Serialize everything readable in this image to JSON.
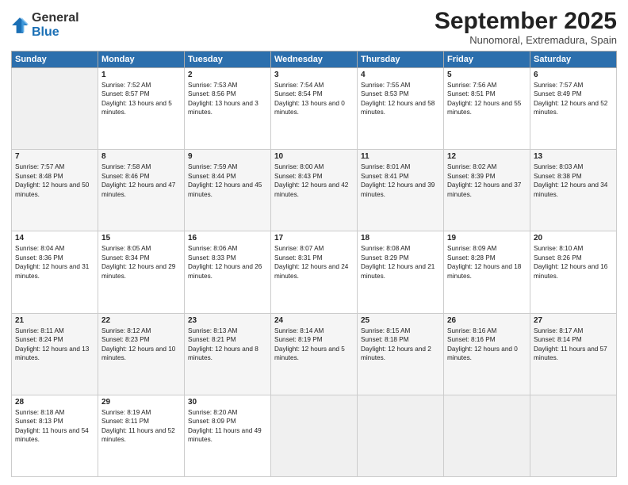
{
  "logo": {
    "general": "General",
    "blue": "Blue"
  },
  "header": {
    "month": "September 2025",
    "location": "Nunomoral, Extremadura, Spain"
  },
  "weekdays": [
    "Sunday",
    "Monday",
    "Tuesday",
    "Wednesday",
    "Thursday",
    "Friday",
    "Saturday"
  ],
  "weeks": [
    [
      {
        "num": "",
        "sunrise": "",
        "sunset": "",
        "daylight": ""
      },
      {
        "num": "1",
        "sunrise": "Sunrise: 7:52 AM",
        "sunset": "Sunset: 8:57 PM",
        "daylight": "Daylight: 13 hours and 5 minutes."
      },
      {
        "num": "2",
        "sunrise": "Sunrise: 7:53 AM",
        "sunset": "Sunset: 8:56 PM",
        "daylight": "Daylight: 13 hours and 3 minutes."
      },
      {
        "num": "3",
        "sunrise": "Sunrise: 7:54 AM",
        "sunset": "Sunset: 8:54 PM",
        "daylight": "Daylight: 13 hours and 0 minutes."
      },
      {
        "num": "4",
        "sunrise": "Sunrise: 7:55 AM",
        "sunset": "Sunset: 8:53 PM",
        "daylight": "Daylight: 12 hours and 58 minutes."
      },
      {
        "num": "5",
        "sunrise": "Sunrise: 7:56 AM",
        "sunset": "Sunset: 8:51 PM",
        "daylight": "Daylight: 12 hours and 55 minutes."
      },
      {
        "num": "6",
        "sunrise": "Sunrise: 7:57 AM",
        "sunset": "Sunset: 8:49 PM",
        "daylight": "Daylight: 12 hours and 52 minutes."
      }
    ],
    [
      {
        "num": "7",
        "sunrise": "Sunrise: 7:57 AM",
        "sunset": "Sunset: 8:48 PM",
        "daylight": "Daylight: 12 hours and 50 minutes."
      },
      {
        "num": "8",
        "sunrise": "Sunrise: 7:58 AM",
        "sunset": "Sunset: 8:46 PM",
        "daylight": "Daylight: 12 hours and 47 minutes."
      },
      {
        "num": "9",
        "sunrise": "Sunrise: 7:59 AM",
        "sunset": "Sunset: 8:44 PM",
        "daylight": "Daylight: 12 hours and 45 minutes."
      },
      {
        "num": "10",
        "sunrise": "Sunrise: 8:00 AM",
        "sunset": "Sunset: 8:43 PM",
        "daylight": "Daylight: 12 hours and 42 minutes."
      },
      {
        "num": "11",
        "sunrise": "Sunrise: 8:01 AM",
        "sunset": "Sunset: 8:41 PM",
        "daylight": "Daylight: 12 hours and 39 minutes."
      },
      {
        "num": "12",
        "sunrise": "Sunrise: 8:02 AM",
        "sunset": "Sunset: 8:39 PM",
        "daylight": "Daylight: 12 hours and 37 minutes."
      },
      {
        "num": "13",
        "sunrise": "Sunrise: 8:03 AM",
        "sunset": "Sunset: 8:38 PM",
        "daylight": "Daylight: 12 hours and 34 minutes."
      }
    ],
    [
      {
        "num": "14",
        "sunrise": "Sunrise: 8:04 AM",
        "sunset": "Sunset: 8:36 PM",
        "daylight": "Daylight: 12 hours and 31 minutes."
      },
      {
        "num": "15",
        "sunrise": "Sunrise: 8:05 AM",
        "sunset": "Sunset: 8:34 PM",
        "daylight": "Daylight: 12 hours and 29 minutes."
      },
      {
        "num": "16",
        "sunrise": "Sunrise: 8:06 AM",
        "sunset": "Sunset: 8:33 PM",
        "daylight": "Daylight: 12 hours and 26 minutes."
      },
      {
        "num": "17",
        "sunrise": "Sunrise: 8:07 AM",
        "sunset": "Sunset: 8:31 PM",
        "daylight": "Daylight: 12 hours and 24 minutes."
      },
      {
        "num": "18",
        "sunrise": "Sunrise: 8:08 AM",
        "sunset": "Sunset: 8:29 PM",
        "daylight": "Daylight: 12 hours and 21 minutes."
      },
      {
        "num": "19",
        "sunrise": "Sunrise: 8:09 AM",
        "sunset": "Sunset: 8:28 PM",
        "daylight": "Daylight: 12 hours and 18 minutes."
      },
      {
        "num": "20",
        "sunrise": "Sunrise: 8:10 AM",
        "sunset": "Sunset: 8:26 PM",
        "daylight": "Daylight: 12 hours and 16 minutes."
      }
    ],
    [
      {
        "num": "21",
        "sunrise": "Sunrise: 8:11 AM",
        "sunset": "Sunset: 8:24 PM",
        "daylight": "Daylight: 12 hours and 13 minutes."
      },
      {
        "num": "22",
        "sunrise": "Sunrise: 8:12 AM",
        "sunset": "Sunset: 8:23 PM",
        "daylight": "Daylight: 12 hours and 10 minutes."
      },
      {
        "num": "23",
        "sunrise": "Sunrise: 8:13 AM",
        "sunset": "Sunset: 8:21 PM",
        "daylight": "Daylight: 12 hours and 8 minutes."
      },
      {
        "num": "24",
        "sunrise": "Sunrise: 8:14 AM",
        "sunset": "Sunset: 8:19 PM",
        "daylight": "Daylight: 12 hours and 5 minutes."
      },
      {
        "num": "25",
        "sunrise": "Sunrise: 8:15 AM",
        "sunset": "Sunset: 8:18 PM",
        "daylight": "Daylight: 12 hours and 2 minutes."
      },
      {
        "num": "26",
        "sunrise": "Sunrise: 8:16 AM",
        "sunset": "Sunset: 8:16 PM",
        "daylight": "Daylight: 12 hours and 0 minutes."
      },
      {
        "num": "27",
        "sunrise": "Sunrise: 8:17 AM",
        "sunset": "Sunset: 8:14 PM",
        "daylight": "Daylight: 11 hours and 57 minutes."
      }
    ],
    [
      {
        "num": "28",
        "sunrise": "Sunrise: 8:18 AM",
        "sunset": "Sunset: 8:13 PM",
        "daylight": "Daylight: 11 hours and 54 minutes."
      },
      {
        "num": "29",
        "sunrise": "Sunrise: 8:19 AM",
        "sunset": "Sunset: 8:11 PM",
        "daylight": "Daylight: 11 hours and 52 minutes."
      },
      {
        "num": "30",
        "sunrise": "Sunrise: 8:20 AM",
        "sunset": "Sunset: 8:09 PM",
        "daylight": "Daylight: 11 hours and 49 minutes."
      },
      {
        "num": "",
        "sunrise": "",
        "sunset": "",
        "daylight": ""
      },
      {
        "num": "",
        "sunrise": "",
        "sunset": "",
        "daylight": ""
      },
      {
        "num": "",
        "sunrise": "",
        "sunset": "",
        "daylight": ""
      },
      {
        "num": "",
        "sunrise": "",
        "sunset": "",
        "daylight": ""
      }
    ]
  ]
}
